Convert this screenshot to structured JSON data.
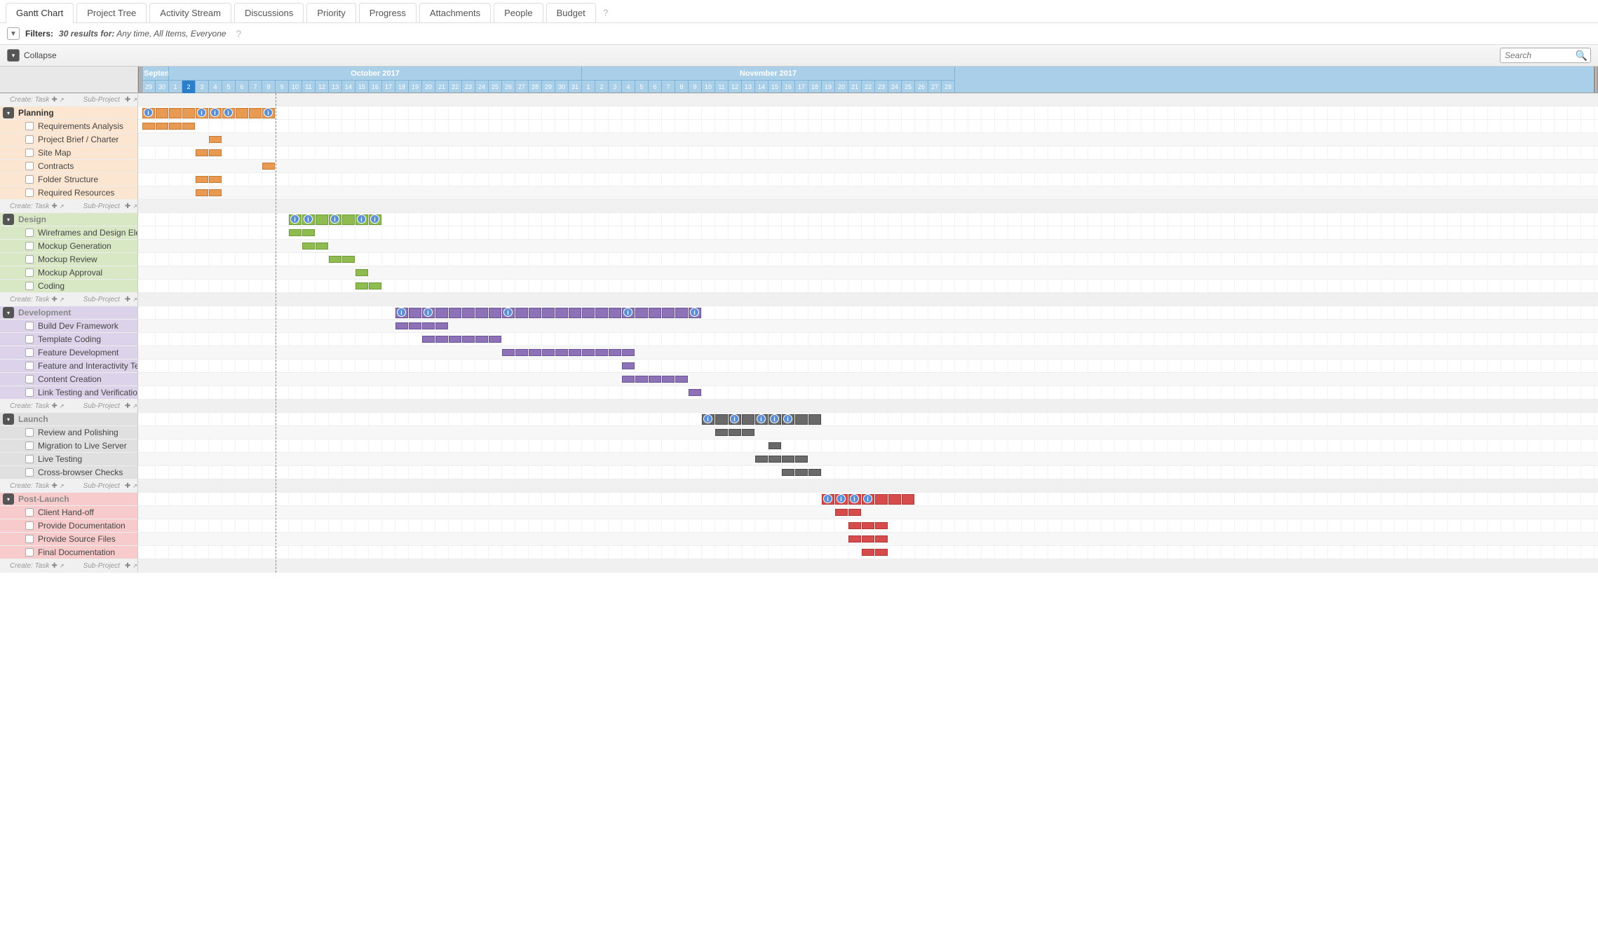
{
  "tabs": [
    "Gantt Chart",
    "Project Tree",
    "Activity Stream",
    "Discussions",
    "Priority",
    "Progress",
    "Attachments",
    "People",
    "Budget"
  ],
  "active_tab": 0,
  "filters": {
    "label": "Filters:",
    "results_prefix": "30 results for:",
    "criteria": "Any time, All Items, Everyone"
  },
  "toolbar": {
    "collapse": "Collapse",
    "search_placeholder": "Search"
  },
  "create": {
    "task": "Create: Task",
    "subproject": "Sub-Project"
  },
  "timeline": {
    "months": [
      {
        "label": "Septem",
        "span": 2,
        "partial": true
      },
      {
        "label": "October 2017",
        "span": 31
      },
      {
        "label": "November 2017",
        "span": 28
      }
    ],
    "days": [
      29,
      30,
      1,
      2,
      3,
      4,
      5,
      6,
      7,
      8,
      9,
      10,
      11,
      12,
      13,
      14,
      15,
      16,
      17,
      18,
      19,
      20,
      21,
      22,
      23,
      24,
      25,
      26,
      27,
      28,
      29,
      30,
      31,
      1,
      2,
      3,
      4,
      5,
      6,
      7,
      8,
      9,
      10,
      11,
      12,
      13,
      14,
      15,
      16,
      17,
      18,
      19,
      20,
      21,
      22,
      23,
      24,
      25,
      26,
      27,
      28
    ],
    "today_index": 3
  },
  "chart_data": {
    "type": "gantt",
    "unit": "day-index (0 = 29 Sep 2017)",
    "groups": [
      {
        "name": "Planning",
        "color": "planning",
        "start": 0,
        "end": 10,
        "info_markers": [
          0,
          4,
          5,
          6,
          9
        ],
        "tasks": [
          {
            "name": "Requirements Analysis",
            "start": 0,
            "end": 4
          },
          {
            "name": "Project Brief / Charter",
            "start": 5,
            "end": 6
          },
          {
            "name": "Site Map",
            "start": 4,
            "end": 6
          },
          {
            "name": "Contracts",
            "start": 9,
            "end": 10
          },
          {
            "name": "Folder Structure",
            "start": 4,
            "end": 6
          },
          {
            "name": "Required Resources",
            "start": 4,
            "end": 6
          }
        ]
      },
      {
        "name": "Design",
        "color": "design",
        "start": 11,
        "end": 18,
        "info_markers": [
          11,
          12,
          14,
          16,
          17
        ],
        "tasks": [
          {
            "name": "Wireframes and Design Elem",
            "start": 11,
            "end": 13
          },
          {
            "name": "Mockup Generation",
            "start": 12,
            "end": 14
          },
          {
            "name": "Mockup Review",
            "start": 14,
            "end": 16
          },
          {
            "name": "Mockup Approval",
            "start": 16,
            "end": 17
          },
          {
            "name": "Coding",
            "start": 16,
            "end": 18
          }
        ]
      },
      {
        "name": "Development",
        "color": "development",
        "start": 19,
        "end": 42,
        "info_markers": [
          19,
          21,
          27,
          36,
          41
        ],
        "tasks": [
          {
            "name": "Build Dev Framework",
            "start": 19,
            "end": 23
          },
          {
            "name": "Template Coding",
            "start": 21,
            "end": 27
          },
          {
            "name": "Feature Development",
            "start": 27,
            "end": 37
          },
          {
            "name": "Feature and Interactivity Testi",
            "start": 36,
            "end": 37
          },
          {
            "name": "Content Creation",
            "start": 36,
            "end": 41
          },
          {
            "name": "Link Testing and Verification",
            "start": 41,
            "end": 42
          }
        ]
      },
      {
        "name": "Launch",
        "color": "launch",
        "start": 42,
        "end": 51,
        "info_markers": [
          42,
          44,
          46,
          47,
          48
        ],
        "tasks": [
          {
            "name": "Review and Polishing",
            "start": 43,
            "end": 46
          },
          {
            "name": "Migration to Live Server",
            "start": 47,
            "end": 48
          },
          {
            "name": "Live Testing",
            "start": 46,
            "end": 50
          },
          {
            "name": "Cross-browser Checks",
            "start": 48,
            "end": 51
          }
        ]
      },
      {
        "name": "Post-Launch",
        "color": "postlaunch",
        "start": 51,
        "end": 58,
        "info_markers": [
          51,
          52,
          53,
          54
        ],
        "tasks": [
          {
            "name": "Client Hand-off",
            "start": 52,
            "end": 54
          },
          {
            "name": "Provide Documentation",
            "start": 53,
            "end": 56
          },
          {
            "name": "Provide Source Files",
            "start": 53,
            "end": 56
          },
          {
            "name": "Final Documentation",
            "start": 54,
            "end": 56
          }
        ]
      }
    ]
  }
}
